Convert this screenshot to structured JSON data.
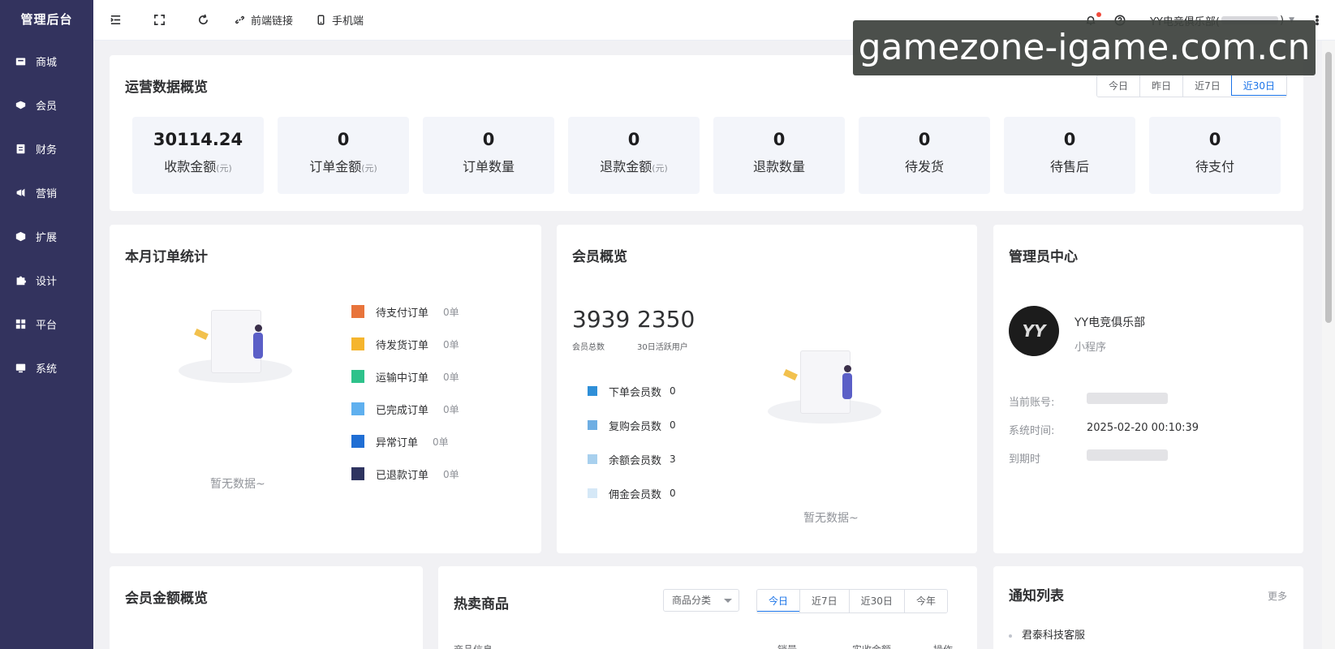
{
  "sidebar": {
    "title": "管理后台",
    "items": [
      {
        "label": "商城",
        "icon": "store-icon"
      },
      {
        "label": "会员",
        "icon": "member-icon"
      },
      {
        "label": "财务",
        "icon": "finance-icon"
      },
      {
        "label": "营销",
        "icon": "megaphone-icon"
      },
      {
        "label": "扩展",
        "icon": "cube-icon"
      },
      {
        "label": "设计",
        "icon": "puzzle-icon"
      },
      {
        "label": "平台",
        "icon": "grid-icon"
      },
      {
        "label": "系统",
        "icon": "monitor-icon"
      }
    ]
  },
  "topbar": {
    "front_link": "前端链接",
    "mobile": "手机端",
    "user_label": "YY电竞俱乐部("
  },
  "watermark": "gamezone-igame.com.cn",
  "overview": {
    "title": "运营数据概览",
    "ranges": [
      "今日",
      "昨日",
      "近7日",
      "近30日"
    ],
    "active_range": "近30日",
    "stats": [
      {
        "value": "30114.24",
        "label": "收款金额",
        "unit": "(元)"
      },
      {
        "value": "0",
        "label": "订单金额",
        "unit": "(元)"
      },
      {
        "value": "0",
        "label": "订单数量",
        "unit": ""
      },
      {
        "value": "0",
        "label": "退款金额",
        "unit": "(元)"
      },
      {
        "value": "0",
        "label": "退款数量",
        "unit": ""
      },
      {
        "value": "0",
        "label": "待发货",
        "unit": ""
      },
      {
        "value": "0",
        "label": "待售后",
        "unit": ""
      },
      {
        "value": "0",
        "label": "待支付",
        "unit": ""
      }
    ]
  },
  "order_stats": {
    "title": "本月订单统计",
    "empty": "暂无数据~",
    "legend": [
      {
        "label": "待支付订单",
        "value": "0单",
        "color": "#e8743b"
      },
      {
        "label": "待发货订单",
        "value": "0单",
        "color": "#f5b52e"
      },
      {
        "label": "运输中订单",
        "value": "0单",
        "color": "#2ec28b"
      },
      {
        "label": "已完成订单",
        "value": "0单",
        "color": "#5fb0ef"
      },
      {
        "label": "异常订单",
        "value": "0单",
        "color": "#1f6ed4"
      },
      {
        "label": "已退款订单",
        "value": "0单",
        "color": "#2e3460"
      }
    ]
  },
  "member_overview": {
    "title": "会员概览",
    "total": "3939",
    "total_label": "会员总数",
    "active": "2350",
    "active_label": "30日活跃用户",
    "empty": "暂无数据~",
    "legend": [
      {
        "label": "下单会员数",
        "value": "0",
        "color": "#2f8fd8"
      },
      {
        "label": "复购会员数",
        "value": "0",
        "color": "#6eaee3"
      },
      {
        "label": "余额会员数",
        "value": "3",
        "color": "#a8d0ee"
      },
      {
        "label": "佣金会员数",
        "value": "0",
        "color": "#d5e8f7"
      }
    ]
  },
  "admin": {
    "title": "管理员中心",
    "avatar_text": "YY",
    "name": "YY电竞俱乐部",
    "type": "小程序",
    "account_label": "当前账号:",
    "time_label": "系统时间:",
    "time_value": "2025-02-20 00:10:39",
    "expire_label": "到期时"
  },
  "member_amount": {
    "title": "会员金额概览"
  },
  "hot_goods": {
    "title": "热卖商品",
    "category": "商品分类",
    "ranges": [
      "今日",
      "近7日",
      "近30日",
      "今年"
    ],
    "active_range": "今日",
    "columns": [
      "商品信息",
      "销量",
      "实收金额",
      "操作"
    ]
  },
  "notice": {
    "title": "通知列表",
    "more": "更多",
    "items": [
      "君泰科技客服"
    ]
  }
}
